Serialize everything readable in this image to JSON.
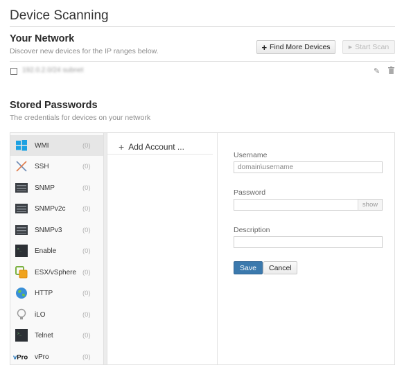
{
  "page": {
    "title": "Device Scanning"
  },
  "network": {
    "heading": "Your Network",
    "subtitle": "Discover new devices for the IP ranges below.",
    "find_more_label": "Find More Devices",
    "start_scan_label": "Start Scan",
    "range_row": {
      "text": "192.0.2.0/24 subnet"
    }
  },
  "passwords": {
    "heading": "Stored Passwords",
    "subtitle": "The credentials for devices on your network",
    "protocols": [
      {
        "name": "WMI",
        "count": "(0)",
        "icon": "windows-icon"
      },
      {
        "name": "SSH",
        "count": "(0)",
        "icon": "ssh-icon"
      },
      {
        "name": "SNMP",
        "count": "(0)",
        "icon": "server-icon"
      },
      {
        "name": "SNMPv2c",
        "count": "(0)",
        "icon": "server-icon"
      },
      {
        "name": "SNMPv3",
        "count": "(0)",
        "icon": "server-icon"
      },
      {
        "name": "Enable",
        "count": "(0)",
        "icon": "terminal-icon"
      },
      {
        "name": "ESX/vSphere",
        "count": "(0)",
        "icon": "vsphere-icon"
      },
      {
        "name": "HTTP",
        "count": "(0)",
        "icon": "globe-icon"
      },
      {
        "name": "iLO",
        "count": "(0)",
        "icon": "bulb-icon"
      },
      {
        "name": "Telnet",
        "count": "(0)",
        "icon": "terminal-icon"
      },
      {
        "name": "vPro",
        "count": "(0)",
        "icon": "vpro-logo-icon"
      }
    ],
    "add_account_label": "Add Account ...",
    "form": {
      "username_label": "Username",
      "username_placeholder": "domain\\username",
      "password_label": "Password",
      "show_label": "show",
      "description_label": "Description",
      "save_label": "Save",
      "cancel_label": "Cancel"
    }
  },
  "colors": {
    "primary": "#3b79ad",
    "selected_row": "#e6e6e6"
  }
}
